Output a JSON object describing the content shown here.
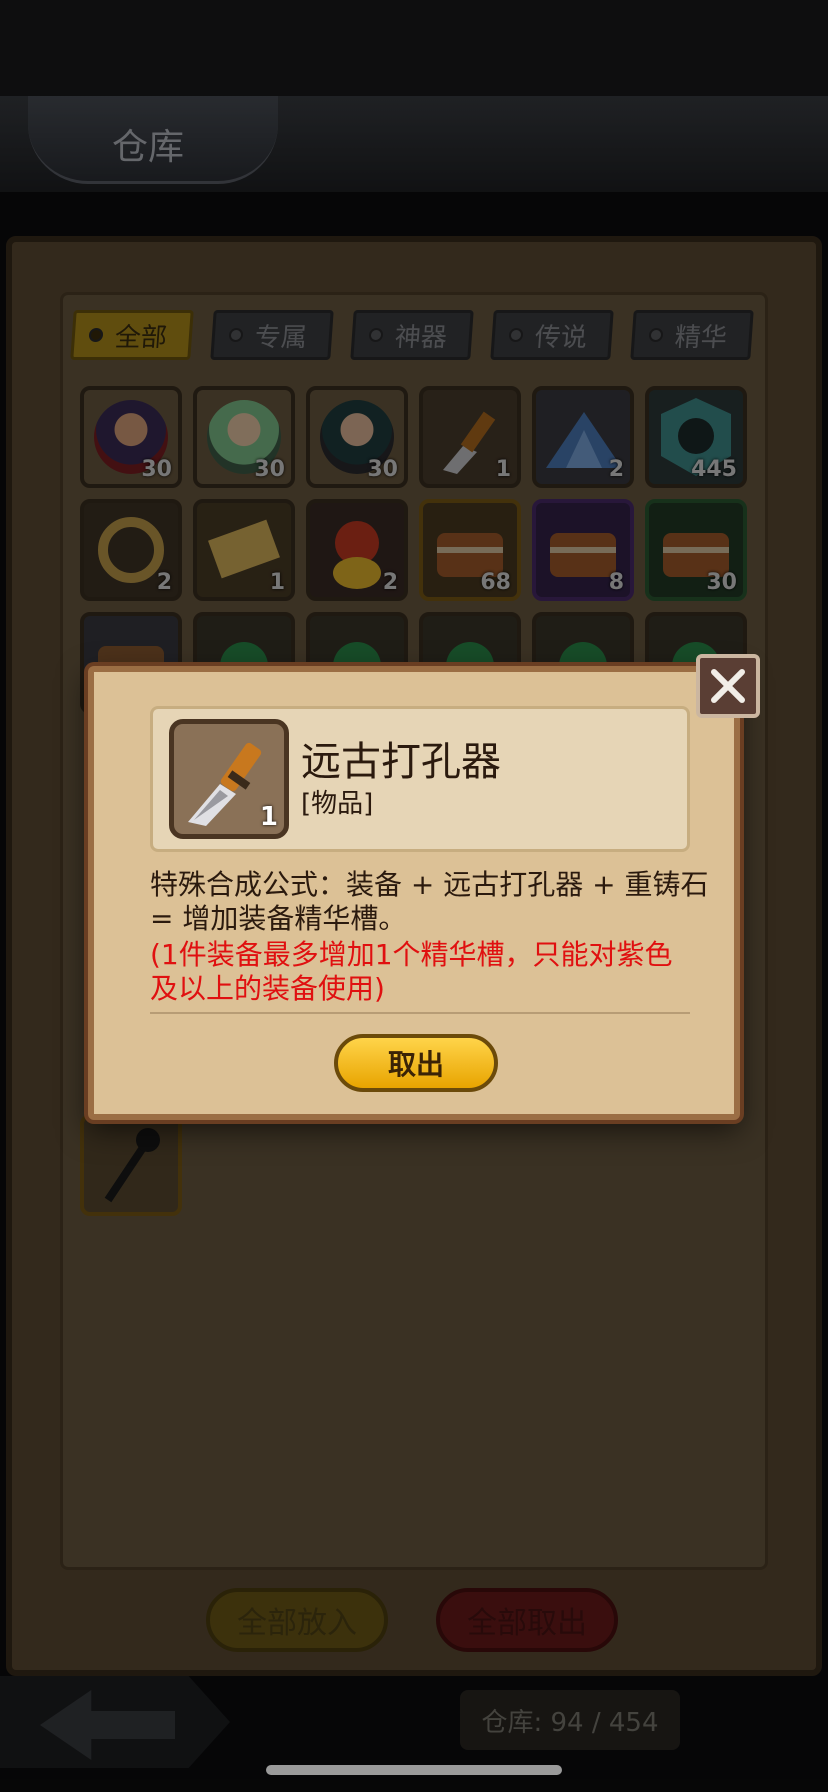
{
  "header": {
    "title": "仓库"
  },
  "tabs": [
    {
      "label": "全部",
      "active": true
    },
    {
      "label": "专属",
      "active": false
    },
    {
      "label": "神器",
      "active": false
    },
    {
      "label": "传说",
      "active": false
    },
    {
      "label": "精华",
      "active": false
    }
  ],
  "grid": [
    {
      "icon": "hero-portrait-icon",
      "count": "30",
      "frame": "#3a2e1f",
      "bg": "#2c2a3e"
    },
    {
      "icon": "hero-portrait-icon",
      "count": "30",
      "frame": "#3a2e1f",
      "bg": "#3c4a3e"
    },
    {
      "icon": "hero-portrait-icon",
      "count": "30",
      "frame": "#3a2e1f",
      "bg": "#2d3a3c"
    },
    {
      "icon": "chisel-icon",
      "count": "1",
      "frame": "#3a2e1f",
      "bg": "#4a3c2c"
    },
    {
      "icon": "crystal-pile-icon",
      "count": "2",
      "frame": "#3a2e1f",
      "bg": "#3a3a40"
    },
    {
      "icon": "rune-stone-icon",
      "count": "445",
      "frame": "#3a2e1f",
      "bg": "#2c3a3a"
    },
    {
      "icon": "gold-ring-icon",
      "count": "2",
      "frame": "#3a2e1f",
      "bg": "#3e3325"
    },
    {
      "icon": "ticket-icon",
      "count": "1",
      "frame": "#3a2e1f",
      "bg": "#4a3c26"
    },
    {
      "icon": "hooded-figure-icon",
      "count": "2",
      "frame": "#3a2e1f",
      "bg": "#3a2a26"
    },
    {
      "icon": "treasure-chest-icon",
      "count": "68",
      "frame": "#7a5a14",
      "bg": "#4a3a20"
    },
    {
      "icon": "treasure-chest-icon",
      "count": "8",
      "frame": "#4a2a6a",
      "bg": "#33224a"
    },
    {
      "icon": "treasure-chest-icon",
      "count": "30",
      "frame": "#2a5a32",
      "bg": "#223a26"
    }
  ],
  "row3": [
    {
      "icon": "treasure-chest-icon"
    },
    {
      "icon": "green-gem-icon"
    },
    {
      "icon": "green-gem-icon"
    },
    {
      "icon": "green-gem-icon"
    },
    {
      "icon": "green-gem-icon"
    },
    {
      "icon": "green-gem-icon"
    }
  ],
  "bottom": {
    "put_all": "全部放入",
    "take_all": "全部取出",
    "capacity": "仓库: 94 / 454"
  },
  "modal": {
    "item_name": "远古打孔器",
    "item_type": "[物品]",
    "item_count": "1",
    "description": "特殊合成公式：装备 + 远古打孔器 + 重铸石 = 增加装备精华槽。",
    "note": "(1件装备最多增加1个精华槽，只能对紫色及以上的装备使用)",
    "button": "取出"
  },
  "colors": {
    "note_red": "#e01010",
    "button_gold": "#f2be1a",
    "parchment": "#dcc196"
  }
}
